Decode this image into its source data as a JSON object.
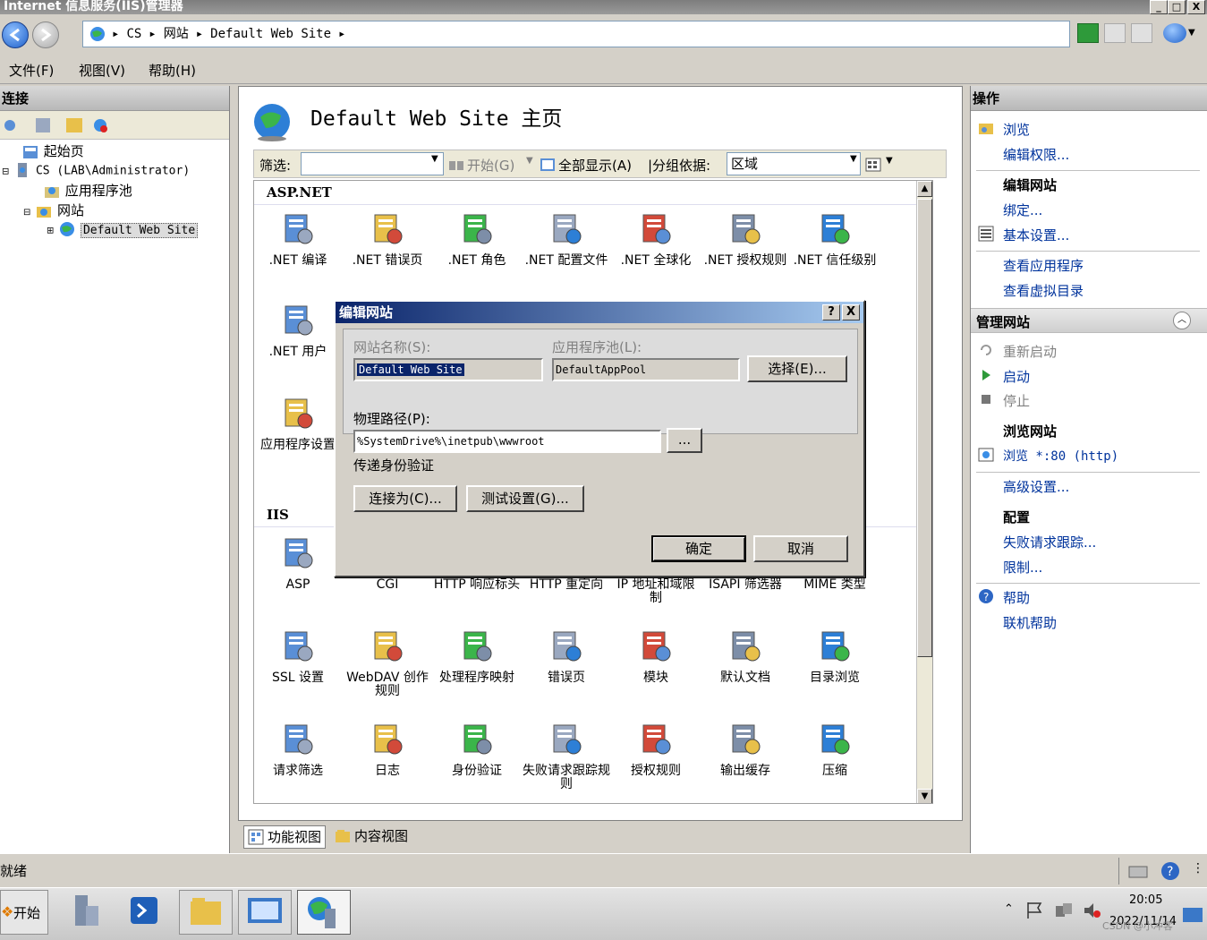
{
  "window": {
    "title": "Internet 信息服务(IIS)管理器",
    "minimize": "_",
    "maximize": "□",
    "close": "X"
  },
  "address": {
    "crumbs": [
      "▸",
      "CS",
      "▸",
      "网站",
      "▸",
      "Default Web Site",
      "▸"
    ]
  },
  "menu": {
    "file": "文件(F)",
    "view": "视图(V)",
    "help": "帮助(H)"
  },
  "connections": {
    "header": "连接",
    "tree": [
      {
        "label": "起始页"
      },
      {
        "label": "CS (LAB\\Administrator)"
      },
      {
        "label": "应用程序池"
      },
      {
        "label": "网站"
      },
      {
        "label": "Default Web Site"
      }
    ]
  },
  "center": {
    "title": "Default Web Site 主页",
    "filter": {
      "label": "筛选:",
      "start": "开始(G)",
      "showall": "全部显示(A)",
      "groupby": "|分组依据:",
      "groupvalue": "区域"
    },
    "groups": {
      "aspnet": "ASP.NET",
      "iis": "IIS"
    },
    "aspnet_features": [
      {
        "label": ".NET 编译",
        "icon": "compile-icon"
      },
      {
        "label": ".NET 错误页",
        "icon": "error-404-icon"
      },
      {
        "label": ".NET 角色",
        "icon": "roles-icon"
      },
      {
        "label": ".NET 配置文件",
        "icon": "profile-icon"
      },
      {
        "label": ".NET 全球化",
        "icon": "globe-icon"
      },
      {
        "label": ".NET 授权规则",
        "icon": "auth-lock-icon"
      },
      {
        "label": ".NET 信任级别",
        "icon": "trust-icon"
      },
      {
        "label": ".NET 用户",
        "icon": "users-icon"
      },
      {
        "label": "应用程序设置",
        "icon": "app-settings-icon"
      }
    ],
    "iis_features": [
      {
        "label": "ASP",
        "icon": "asp-icon"
      },
      {
        "label": "CGI",
        "icon": "cgi-icon"
      },
      {
        "label": "HTTP 响应标头",
        "icon": "http-headers-icon"
      },
      {
        "label": "HTTP 重定向",
        "icon": "redirect-icon"
      },
      {
        "label": "IP 地址和域限制",
        "icon": "ip-restrict-icon"
      },
      {
        "label": "ISAPI 筛选器",
        "icon": "isapi-icon"
      },
      {
        "label": "MIME 类型",
        "icon": "mime-icon"
      },
      {
        "label": "SSL 设置",
        "icon": "ssl-lock-icon"
      },
      {
        "label": "WebDAV 创作规则",
        "icon": "webdav-icon"
      },
      {
        "label": "处理程序映射",
        "icon": "handler-icon"
      },
      {
        "label": "错误页",
        "icon": "error-page-icon"
      },
      {
        "label": "模块",
        "icon": "modules-icon"
      },
      {
        "label": "默认文档",
        "icon": "default-doc-icon"
      },
      {
        "label": "目录浏览",
        "icon": "dir-browse-icon"
      },
      {
        "label": "请求筛选",
        "icon": "request-filter-icon"
      },
      {
        "label": "日志",
        "icon": "log-icon"
      },
      {
        "label": "身份验证",
        "icon": "authentication-icon"
      },
      {
        "label": "失败请求跟踪规则",
        "icon": "failed-request-icon"
      },
      {
        "label": "授权规则",
        "icon": "authorization-icon"
      },
      {
        "label": "输出缓存",
        "icon": "output-cache-icon"
      },
      {
        "label": "压缩",
        "icon": "compression-icon"
      }
    ],
    "tabs": {
      "feature": "功能视图",
      "content": "内容视图"
    }
  },
  "actions": {
    "header": "操作",
    "browse": "浏览",
    "edit_perms": "编辑权限...",
    "edit_site": "编辑网站",
    "bindings": "绑定...",
    "basic_settings": "基本设置...",
    "view_apps": "查看应用程序",
    "view_vdirs": "查看虚拟目录",
    "manage_site": "管理网站",
    "restart": "重新启动",
    "start": "启动",
    "stop": "停止",
    "browse_site": "浏览网站",
    "browse_80": "浏览 *:80 (http)",
    "advanced": "高级设置...",
    "config": "配置",
    "failed_trace": "失败请求跟踪...",
    "limits": "限制...",
    "help": "帮助",
    "online_help": "联机帮助"
  },
  "status": {
    "text": "就绪"
  },
  "taskbar": {
    "start": "开始",
    "time": "20:05",
    "date": "2022/11/14",
    "watermark": "CSDN @小冲客"
  },
  "dialog": {
    "title": "编辑网站",
    "help_btn": "?",
    "close_btn": "X",
    "site_name_label": "网站名称(S):",
    "site_name_value": "Default Web Site",
    "app_pool_label": "应用程序池(L):",
    "app_pool_value": "DefaultAppPool",
    "select_btn": "选择(E)...",
    "phys_path_label": "物理路径(P):",
    "phys_path_value": "%SystemDrive%\\inetpub\\wwwroot",
    "browse_btn": "...",
    "passthrough_label": "传递身份验证",
    "connect_as_btn": "连接为(C)...",
    "test_btn": "测试设置(G)...",
    "ok_btn": "确定",
    "cancel_btn": "取消"
  }
}
